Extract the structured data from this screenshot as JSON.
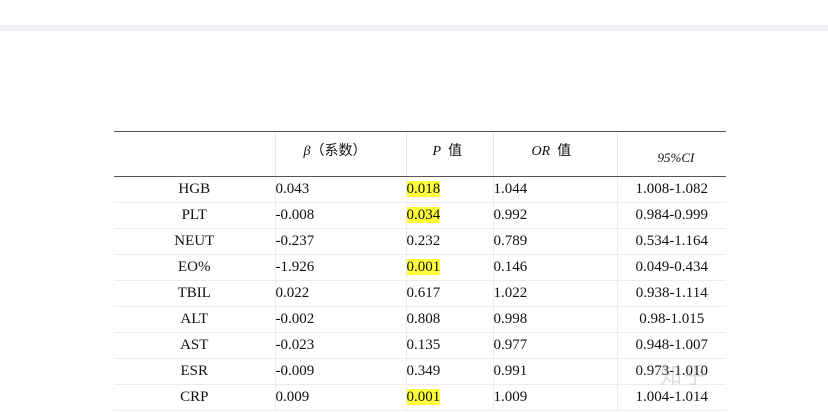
{
  "table": {
    "headers": {
      "beta_symbol": "β",
      "beta_label": "（系数）",
      "p_symbol": "P",
      "p_label": "值",
      "or_symbol": "OR",
      "or_label": "值",
      "ci_label": "95%CI"
    },
    "rows": [
      {
        "name": "HGB",
        "beta": "0.043",
        "p": "0.018",
        "p_highlight": true,
        "or": "1.044",
        "ci": "1.008-1.082"
      },
      {
        "name": "PLT",
        "beta": "-0.008",
        "p": "0.034",
        "p_highlight": true,
        "or": "0.992",
        "ci": "0.984-0.999"
      },
      {
        "name": "NEUT",
        "beta": "-0.237",
        "p": "0.232",
        "p_highlight": false,
        "or": "0.789",
        "ci": "0.534-1.164"
      },
      {
        "name": "EO%",
        "beta": "-1.926",
        "p": "0.001",
        "p_highlight": true,
        "or": "0.146",
        "ci": "0.049-0.434"
      },
      {
        "name": "TBIL",
        "beta": "0.022",
        "p": "0.617",
        "p_highlight": false,
        "or": "1.022",
        "ci": "0.938-1.114"
      },
      {
        "name": "ALT",
        "beta": "-0.002",
        "p": "0.808",
        "p_highlight": false,
        "or": "0.998",
        "ci": "0.98-1.015"
      },
      {
        "name": "AST",
        "beta": "-0.023",
        "p": "0.135",
        "p_highlight": false,
        "or": "0.977",
        "ci": "0.948-1.007"
      },
      {
        "name": "ESR",
        "beta": "-0.009",
        "p": "0.349",
        "p_highlight": false,
        "or": "0.991",
        "ci": "0.973-1.010"
      },
      {
        "name": "CRP",
        "beta": "0.009",
        "p": "0.001",
        "p_highlight": true,
        "or": "1.009",
        "ci": "1.004-1.014"
      }
    ]
  },
  "colors": {
    "highlight": "#ffff3a",
    "rule": "#555555",
    "topbar": "#eeeff5"
  }
}
